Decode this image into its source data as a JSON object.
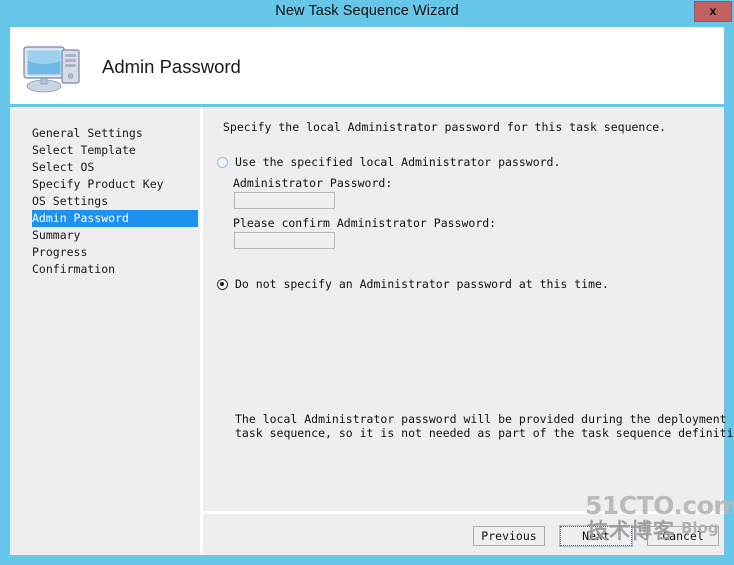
{
  "window": {
    "title": "New Task Sequence Wizard",
    "close_label": "x",
    "accent_color": "#67c7e8",
    "close_color": "#c16060"
  },
  "header": {
    "title": "Admin Password",
    "icon": "computer-monitor-icon"
  },
  "sidebar": {
    "items": [
      {
        "label": "General Settings",
        "selected": false
      },
      {
        "label": "Select Template",
        "selected": false
      },
      {
        "label": "Select OS",
        "selected": false
      },
      {
        "label": "Specify Product Key",
        "selected": false
      },
      {
        "label": "OS Settings",
        "selected": false
      },
      {
        "label": "Admin Password",
        "selected": true
      },
      {
        "label": "Summary",
        "selected": false
      },
      {
        "label": "Progress",
        "selected": false
      },
      {
        "label": "Confirmation",
        "selected": false
      }
    ],
    "selected_color": "#1e90f0"
  },
  "content": {
    "intro": "Specify the local Administrator password for this task sequence.",
    "option1": {
      "label": "Use the specified local Administrator password.",
      "selected": false,
      "password_label": "Administrator Password:",
      "password_value": "",
      "confirm_label": "Please confirm Administrator Password:",
      "confirm_value": ""
    },
    "option2": {
      "label": "Do not specify an Administrator password at this time.",
      "selected": true,
      "description": "The local Administrator password will be provided during the deployment of this\ntask sequence, so it is not needed as part of the task sequence definition."
    }
  },
  "footer": {
    "previous_label": "Previous",
    "next_label": "Next",
    "cancel_label": "Cancel"
  },
  "watermark": {
    "top": "51CTO.com",
    "chinese": "技术博客",
    "blog": "Blog"
  }
}
